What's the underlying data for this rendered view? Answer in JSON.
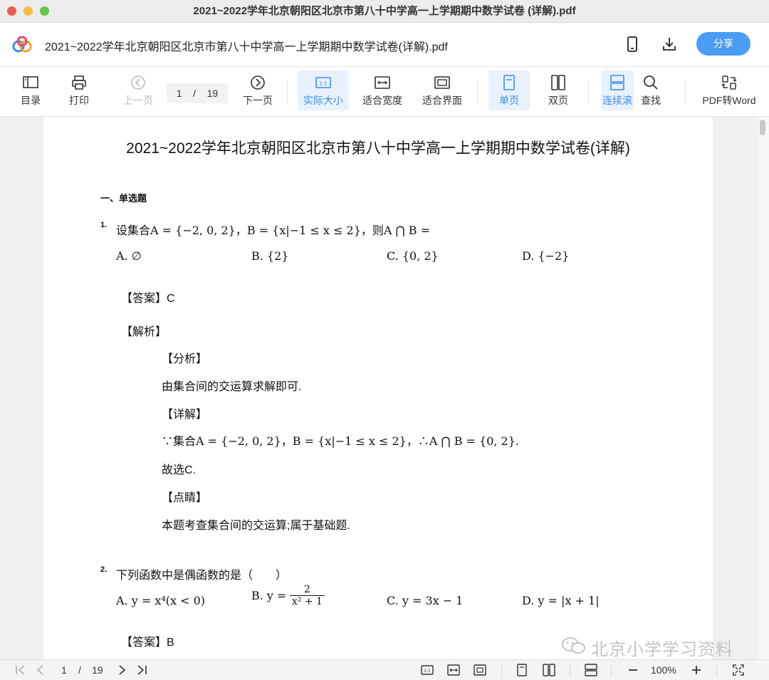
{
  "window": {
    "title": "2021~2022学年北京朝阳区北京市第八十中学高一上学期期中数学试卷 (详解).pdf"
  },
  "header": {
    "doc_title": "2021~2022学年北京朝阳区北京市第八十中学高一上学期期中数学试卷(详解).pdf",
    "share_label": "分享",
    "icons": [
      "phone-icon",
      "download-icon"
    ]
  },
  "toolbar": {
    "toc": "目录",
    "print": "打印",
    "prev": "上一页",
    "page_current": "1",
    "page_sep": "/",
    "page_total": "19",
    "next": "下一页",
    "actual_size": "实际大小",
    "fit_width": "适合宽度",
    "fit_window": "适合界面",
    "single_page": "单页",
    "double_page": "双页",
    "continuous": "连续滚",
    "search": "查找",
    "pdf_to_word": "PDF转Word",
    "accent_color": "#3a8ef0"
  },
  "pdf": {
    "title": "2021~2022学年北京朝阳区北京市第八十中学高一上学期期中数学试卷(详解)",
    "section": "一、单选题",
    "q1": {
      "num": "1.",
      "prefix": "设集合",
      "expr_a": "A = {−2, 0, 2}",
      "comma": "，",
      "expr_b": "B = {x|−1 ≤ x ≤ 2}",
      "then": "，则",
      "expr_c": "A ⋂ B =",
      "options": [
        "A. ∅",
        "B. {2}",
        "C. {0, 2}",
        "D. {−2}"
      ],
      "answer": "【答案】C",
      "analysis_head": "【解析】",
      "fenxi": "【分析】",
      "fenxi_text": "由集合间的交运算求解即可.",
      "xiangjie": "【详解】",
      "xiangjie_text": "∵集合A = {−2, 0, 2}，B = {x|−1 ≤ x ≤ 2}，∴A ⋂ B = {0, 2}.",
      "guxuan": "故选C.",
      "dianjing": "【点睛】",
      "dianjing_text": "本题考查集合间的交运算;属于基础题."
    },
    "q2": {
      "num": "2.",
      "text": "下列函数中是偶函数的是（　　）",
      "opt_a": "A. y = x⁴(x < 0)",
      "opt_b_prefix": "B. y =",
      "opt_b_num": "2",
      "opt_b_den": "x² + 1",
      "opt_c": "C. y = 3x − 1",
      "opt_d": "D. y = |x + 1|",
      "answer": "【答案】B"
    }
  },
  "bottombar": {
    "page_current": "1",
    "page_sep": "/",
    "page_total": "19",
    "zoom": "100%"
  },
  "watermark": {
    "text": "北京小学学习资料"
  }
}
